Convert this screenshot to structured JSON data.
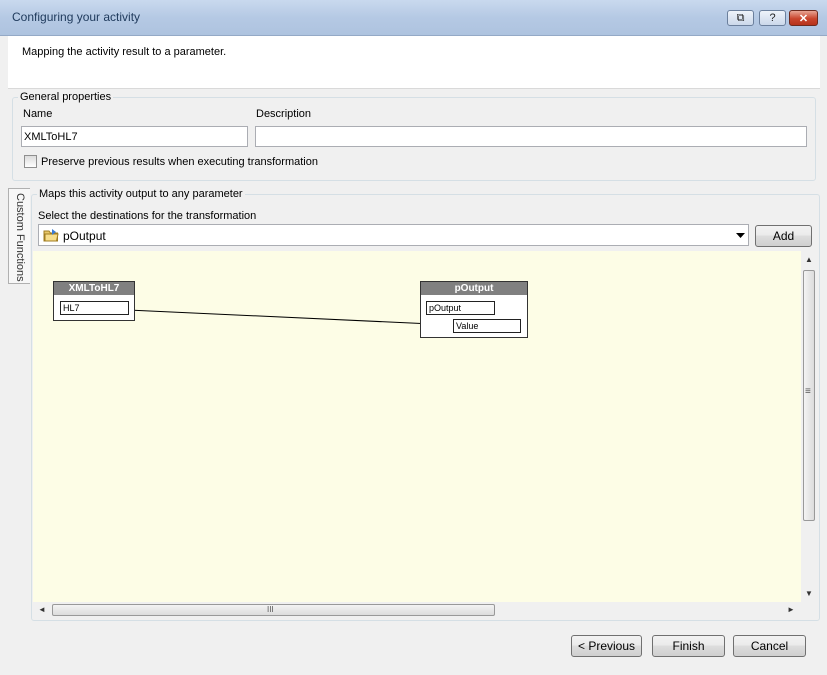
{
  "window": {
    "title": "Configuring your activity",
    "buttons": {
      "restore": "⧉",
      "help": "?",
      "close": "✕"
    }
  },
  "header": {
    "text": "Mapping the activity result to a parameter."
  },
  "general": {
    "legend": "General properties",
    "name_label": "Name",
    "name_value": "XMLToHL7",
    "description_label": "Description",
    "description_value": "",
    "preserve_label": "Preserve previous results when executing transformation",
    "preserve_checked": false
  },
  "side_tab": {
    "label": "Custom Functions"
  },
  "maps": {
    "legend": "Maps this activity output to any parameter",
    "select_label": "Select the destinations for the transformation",
    "selected_value": "pOutput",
    "add_label": "Add"
  },
  "diagram": {
    "source_node": {
      "title": "XMLToHL7",
      "field": "HL7"
    },
    "target_node": {
      "title": "pOutput",
      "root_field": "pOutput",
      "child_field": "Value"
    }
  },
  "scroll": {
    "up": "▲",
    "down": "▼",
    "left": "◄",
    "right": "►",
    "grip_v": "≡",
    "grip_h": "III"
  },
  "footer": {
    "previous": "< Previous",
    "finish": "Finish",
    "cancel": "Cancel"
  },
  "colors": {
    "canvas": "#fdfde6",
    "node_header": "#808080",
    "titlebar": "#b5c9e4"
  }
}
